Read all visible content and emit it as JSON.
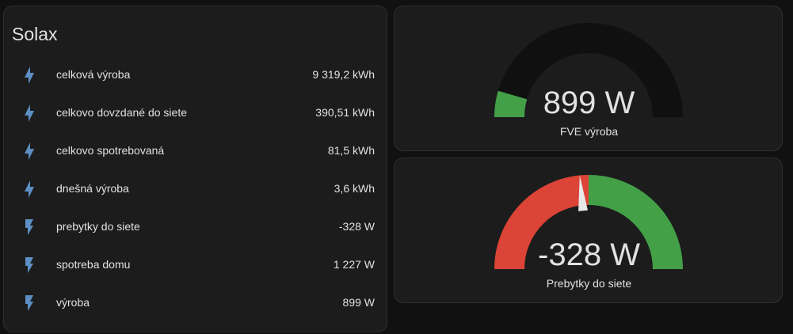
{
  "entities_card": {
    "title": "Solax",
    "rows": [
      {
        "name": "celková výroba",
        "value": "9 319,2 kWh",
        "icon": "flash-icon"
      },
      {
        "name": "celkovo dovzdané do siete",
        "value": "390,51 kWh",
        "icon": "flash-icon"
      },
      {
        "name": "celkovo spotrebovaná",
        "value": "81,5 kWh",
        "icon": "flash-icon"
      },
      {
        "name": "dnešná výroba",
        "value": "3,6 kWh",
        "icon": "flash-icon"
      },
      {
        "name": "prebytky do siete",
        "value": "-328 W",
        "icon": "lightning-bolt-icon"
      },
      {
        "name": "spotreba domu",
        "value": "1 227 W",
        "icon": "lightning-bolt-icon"
      },
      {
        "name": "výroba",
        "value": "899 W",
        "icon": "lightning-bolt-icon"
      }
    ]
  },
  "gauge_fve": {
    "value": "899 W",
    "name": "FVE výroba",
    "fill_fraction": 0.09,
    "fill_color": "#43a047",
    "track_color": "#101010"
  },
  "gauge_prebytky": {
    "value": "-328 W",
    "name": "Prebytky do siete",
    "needle_fraction": 0.47,
    "left_color": "#db4437",
    "right_color": "#43a047"
  },
  "colors": {
    "icon": "#5c8fc4",
    "text": "#e1e1e1",
    "card": "#1c1c1c",
    "background": "#111111"
  }
}
